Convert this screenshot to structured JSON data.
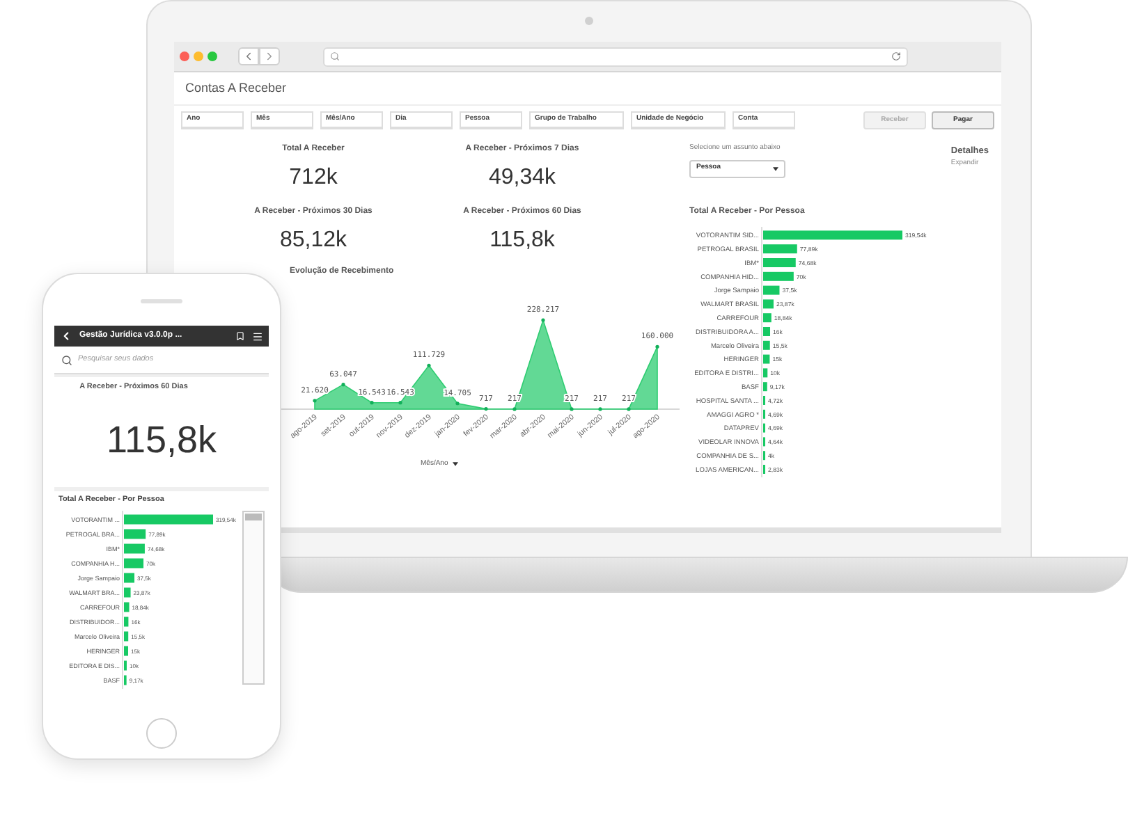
{
  "laptop": {
    "page_title": "Contas A Receber",
    "filters": [
      "Ano",
      "Mês",
      "Mês/Ano",
      "Dia",
      "Pessoa",
      "Grupo de Trabalho",
      "Unidade de Negócio",
      "Conta"
    ],
    "buttons": [
      {
        "label": "Receber",
        "disabled": true
      },
      {
        "label": "Pagar",
        "disabled": false
      }
    ],
    "kpis": [
      {
        "title": "Total A Receber",
        "value": "712k"
      },
      {
        "title": "A Receber - Próximos 7 Dias",
        "value": "49,34k"
      },
      {
        "title": "A Receber - Próximos 30 Dias",
        "value": "85,12k"
      },
      {
        "title": "A Receber - Próximos 60 Dias",
        "value": "115,8k"
      }
    ],
    "timeline": {
      "title": "Evolução de Recebimento",
      "axis_label": "Mês/Ano",
      "chart_data": {
        "type": "area",
        "categories": [
          "ago-2019",
          "set-2019",
          "out-2019",
          "nov-2019",
          "dez-2019",
          "jan-2020",
          "fev-2020",
          "mar-2020",
          "abr-2020",
          "mai-2020",
          "jun-2020",
          "jul-2020",
          "ago-2020"
        ],
        "values": [
          21620,
          63047,
          16543,
          16543,
          111729,
          14705,
          717,
          217,
          228217,
          217,
          217,
          217,
          160000
        ],
        "value_labels": [
          "21.620",
          "63.047",
          "16.543",
          "16.543",
          "111.729",
          "14.705",
          "717",
          "217",
          "228.217",
          "217",
          "217",
          "217",
          "160.000"
        ]
      }
    },
    "subject_select": {
      "label": "Selecione um assunto abaixo",
      "value": "Pessoa"
    },
    "details": {
      "title": "Detalhes",
      "link": "Expandir"
    },
    "by_person": {
      "chart_data": {
        "type": "bar",
        "orientation": "horizontal",
        "title": "Total A Receber - Por Pessoa",
        "categories": [
          "VOTORANTIM SID...",
          "PETROGAL BRASIL",
          "IBM*",
          "COMPANHIA HID...",
          "Jorge Sampaio",
          "WALMART BRASIL",
          "CARREFOUR",
          "DISTRIBUIDORA A...",
          "Marcelo Oliveira",
          "HERINGER",
          "EDITORA E DISTRI...",
          "BASF",
          "HOSPITAL SANTA ...",
          "AMAGGI AGRO *",
          "DATAPREV",
          "VIDEOLAR INNOVA",
          "COMPANHIA DE S...",
          "LOJAS AMERICAN..."
        ],
        "values": [
          319540,
          77890,
          74680,
          70000,
          37500,
          23870,
          18840,
          16000,
          15500,
          15000,
          10000,
          9170,
          4720,
          4690,
          4690,
          4640,
          4000,
          2830
        ],
        "value_labels": [
          "319,54k",
          "77,89k",
          "74,68k",
          "70k",
          "37,5k",
          "23,87k",
          "18,84k",
          "16k",
          "15,5k",
          "15k",
          "10k",
          "9,17k",
          "4,72k",
          "4,69k",
          "4,69k",
          "4,64k",
          "4k",
          "2,83k"
        ]
      }
    }
  },
  "phone": {
    "title": "Gestão Jurídica v3.0.0p ...",
    "search": {
      "placeholder": "Pesquisar seus dados"
    },
    "kpi": {
      "title": "A Receber - Próximos 60 Dias",
      "value": "115,8k"
    },
    "by_person": {
      "chart_data": {
        "type": "bar",
        "orientation": "horizontal",
        "title": "Total A Receber - Por Pessoa",
        "categories": [
          "VOTORANTIM ...",
          "PETROGAL BRA...",
          "IBM*",
          "COMPANHIA H...",
          "Jorge Sampaio",
          "WALMART BRA...",
          "CARREFOUR",
          "DISTRIBUIDOR...",
          "Marcelo Oliveira",
          "HERINGER",
          "EDITORA E DIS...",
          "BASF"
        ],
        "values": [
          319540,
          77890,
          74680,
          70000,
          37500,
          23870,
          18840,
          16000,
          15500,
          15000,
          10000,
          9170
        ],
        "value_labels": [
          "319,54k",
          "77,89k",
          "74,68k",
          "70k",
          "37,5k",
          "23,87k",
          "18,84k",
          "16k",
          "15,5k",
          "15k",
          "10k",
          "9,17k"
        ]
      }
    }
  }
}
